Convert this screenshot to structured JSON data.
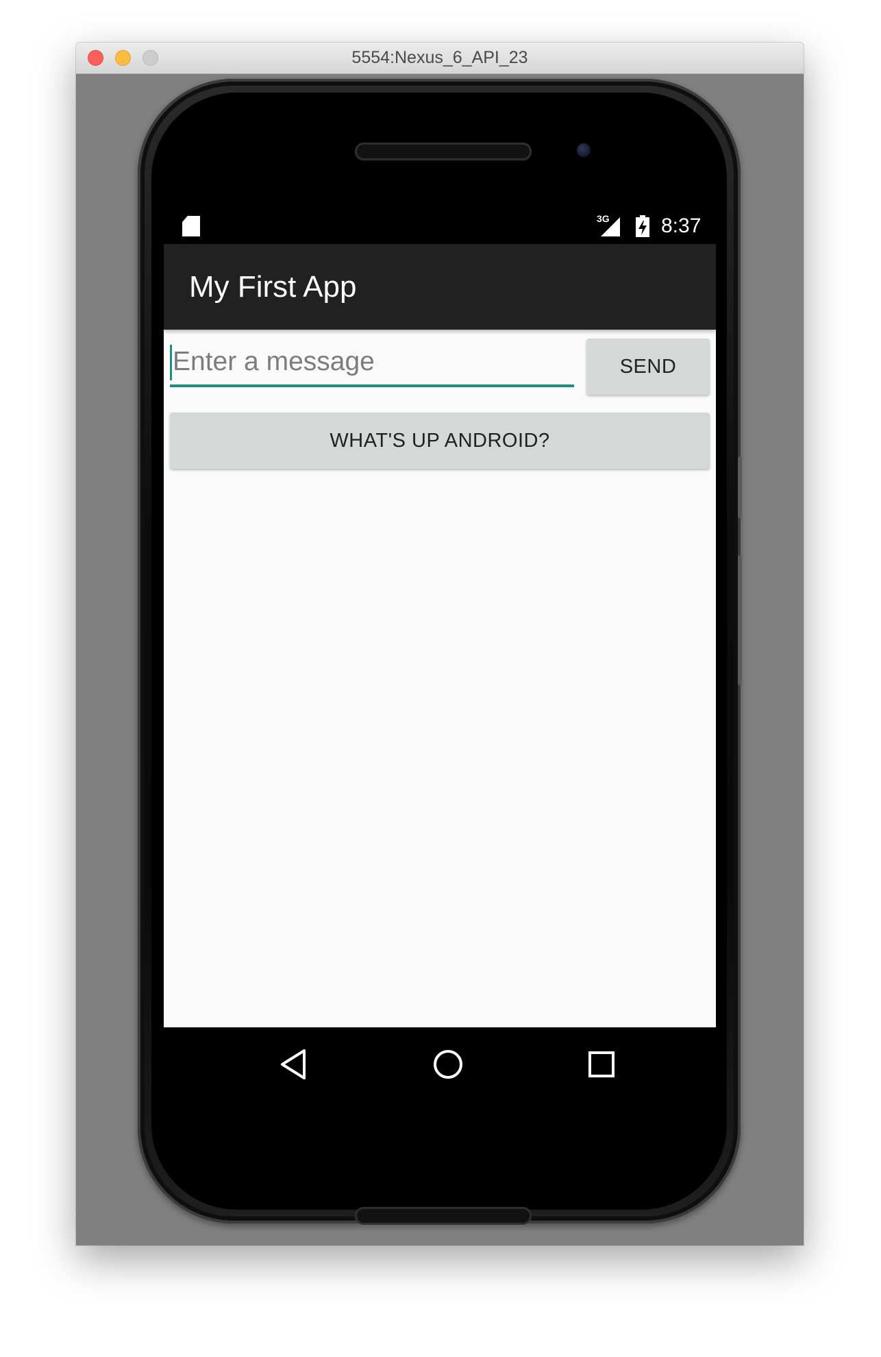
{
  "window": {
    "title": "5554:Nexus_6_API_23"
  },
  "status_bar": {
    "network": "3G",
    "time": "8:37",
    "icons": [
      "sd-card-icon",
      "signal-icon",
      "battery-charging-icon"
    ]
  },
  "app_bar": {
    "title": "My First App"
  },
  "form": {
    "message_placeholder": "Enter a message",
    "message_value": "",
    "send_label": "SEND",
    "whats_up_label": "WHAT'S UP ANDROID?"
  },
  "nav_bar": {
    "icons": [
      "back-icon",
      "home-icon",
      "recents-icon"
    ]
  },
  "colors": {
    "accent": "#199083",
    "app_bar": "#212121",
    "button": "#d6d7d7",
    "content_bg": "#fafafa"
  }
}
